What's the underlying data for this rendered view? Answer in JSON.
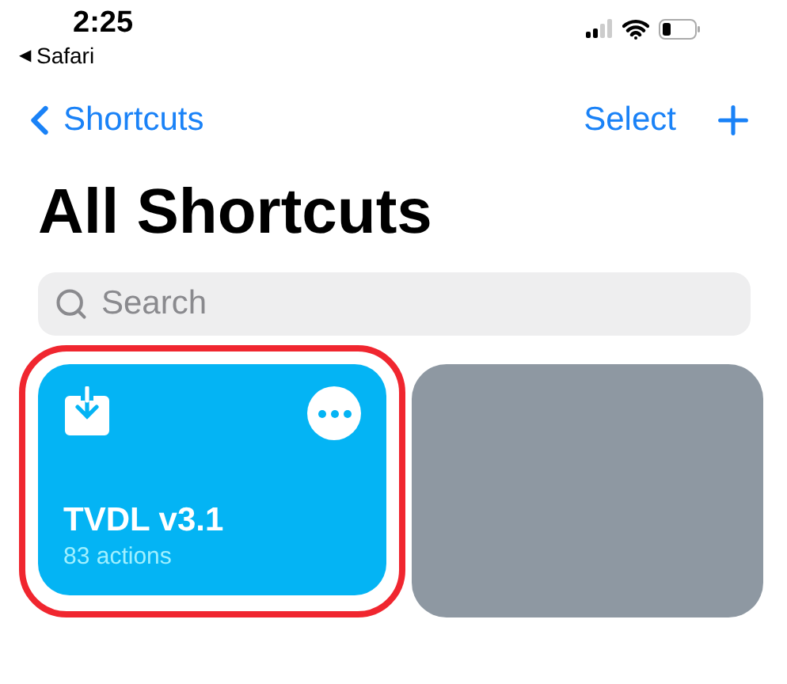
{
  "status_bar": {
    "time": "2:25",
    "back_arrow": "◀",
    "back_app": "Safari"
  },
  "nav": {
    "back_label": "Shortcuts",
    "action": "Select"
  },
  "title": "All Shortcuts",
  "search": {
    "placeholder": "Search"
  },
  "shortcuts": [
    {
      "kind": "shortcut",
      "name": "TVDL v3.1",
      "subtitle": "83 actions",
      "color": "#04b4f4",
      "highlighted": true
    },
    {
      "kind": "blank",
      "color": "#8e98a2",
      "highlighted": false
    }
  ]
}
